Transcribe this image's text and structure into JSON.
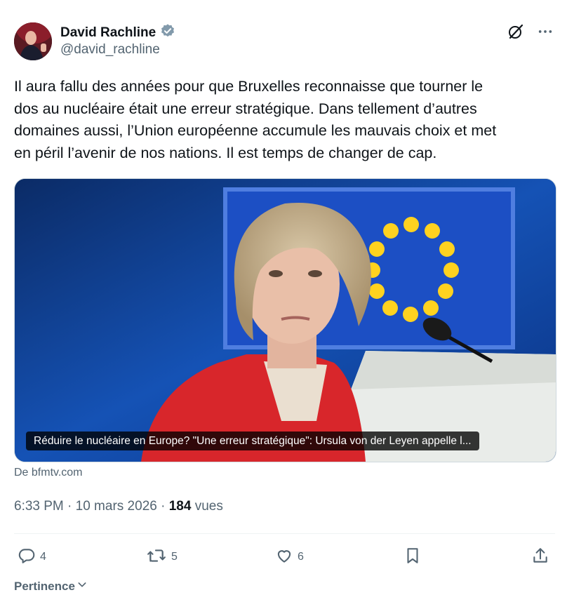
{
  "author": {
    "name": "David Rachline",
    "handle": "@david_rachline",
    "verified_color": "#829aab"
  },
  "tweet": {
    "text": "Il aura fallu des années pour que Bruxelles reconnaisse que tourner le\ndos au nucléaire était une erreur stratégique. Dans tellement d’autres\ndomaines aussi, l’Union européenne accumule les mauvais choix et met\nen péril l’avenir de nos nations. Il est temps de changer de cap."
  },
  "media": {
    "caption": "Réduire le nucléaire en Europe? \"Une erreur stratégique\": Ursula von der Leyen appelle l...",
    "source": "De bfmtv.com"
  },
  "meta": {
    "time": "6:33 PM · 10 mars 2026 · ",
    "views_count": "184",
    "views_label": " vues"
  },
  "actions": {
    "replies": "4",
    "reposts": "5",
    "likes": "6"
  },
  "sort": {
    "label": "Pertinence"
  },
  "icons": [
    "verified-badge-icon",
    "grok-icon",
    "more-icon",
    "reply-icon",
    "repost-icon",
    "like-icon",
    "bookmark-icon",
    "share-icon",
    "chevron-down-icon"
  ]
}
